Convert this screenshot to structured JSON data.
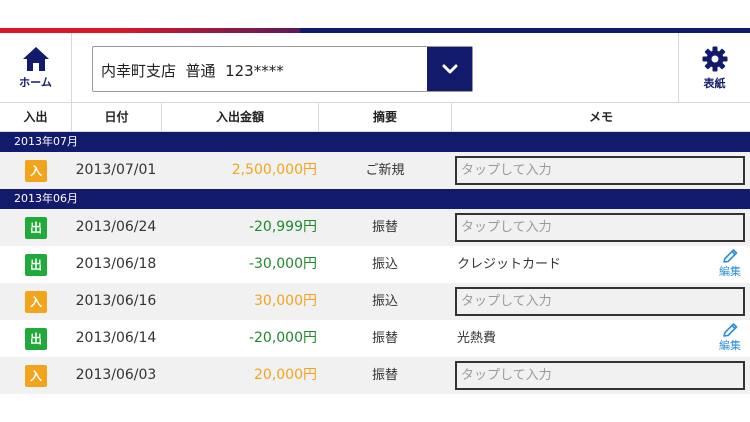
{
  "header": {
    "home_label": "ホーム",
    "account_value": "内幸町支店  普通  123****",
    "cover_label": "表紙"
  },
  "columns": [
    "入出",
    "日付",
    "入出金額",
    "摘要",
    "メモ"
  ],
  "groups": [
    {
      "month": "2013年07月",
      "rows": [
        {
          "type_label": "入",
          "date": "2013/07/01",
          "amount": "2,500,000円",
          "summary": "ご新規",
          "memo_placeholder": "タップして入力"
        }
      ]
    },
    {
      "month": "2013年06月",
      "rows": [
        {
          "type_label": "出",
          "date": "2013/06/24",
          "amount": "-20,999円",
          "summary": "振替",
          "memo_placeholder": "タップして入力"
        },
        {
          "type_label": "出",
          "date": "2013/06/18",
          "amount": "-30,000円",
          "summary": "振込",
          "memo": "クレジットカード",
          "edit_label": "編集"
        },
        {
          "type_label": "入",
          "date": "2013/06/16",
          "amount": "30,000円",
          "summary": "振込",
          "memo_placeholder": "タップして入力"
        },
        {
          "type_label": "出",
          "date": "2013/06/14",
          "amount": "-20,000円",
          "summary": "振替",
          "memo": "光熱費",
          "edit_label": "編集"
        },
        {
          "type_label": "入",
          "date": "2013/06/03",
          "amount": "20,000円",
          "summary": "振替",
          "memo_placeholder": "タップして入力"
        }
      ]
    }
  ],
  "colors": {
    "navy": "#121a6b",
    "deposit": "#f2a41c",
    "withdrawal": "#1faa3a",
    "edit": "#2a8fd4"
  }
}
